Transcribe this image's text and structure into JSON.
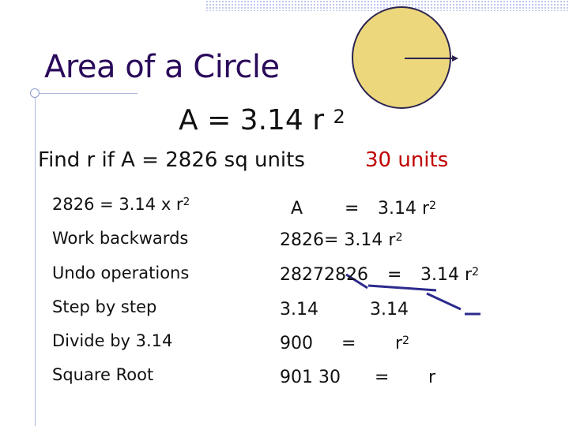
{
  "title": "Area of a Circle",
  "formula": {
    "text": "A  =  3.14 r",
    "exponent": "2"
  },
  "prompt": "Find r if A = 2826 sq units",
  "answer": "30 units",
  "steps": [
    {
      "base": "2826 = 3.14 x r",
      "exp": "2"
    },
    {
      "base": "Work backwards",
      "exp": ""
    },
    {
      "base": "Undo operations",
      "exp": ""
    },
    {
      "base": "Step by step",
      "exp": ""
    },
    {
      "base": "Divide by 3.14",
      "exp": ""
    },
    {
      "base": "Square Root",
      "exp": ""
    }
  ],
  "work": {
    "r1_a": "A",
    "r1_eq": "=",
    "r1_val": "3.14 r",
    "r1_exp": "2",
    "r2_val": "2826=   3.14 r",
    "r2_exp": "2",
    "r3_val": "28272826",
    "r3_eq": "=",
    "r3_rhs": "3.14 r",
    "r3_exp": "2",
    "r4_left": "3.14",
    "r4_right": "3.14",
    "r5_left": "900",
    "r5_eq": "=",
    "r5_r": "r",
    "r5_exp": "2",
    "r6_left": "901  30",
    "r6_eq": "=",
    "r6_r": "r"
  },
  "colors": {
    "title": "#2a0a5a",
    "answer": "#c00000",
    "circle_fill": "#ecd77c",
    "circle_stroke": "#2b2350",
    "strike": "#2c2a8c"
  }
}
